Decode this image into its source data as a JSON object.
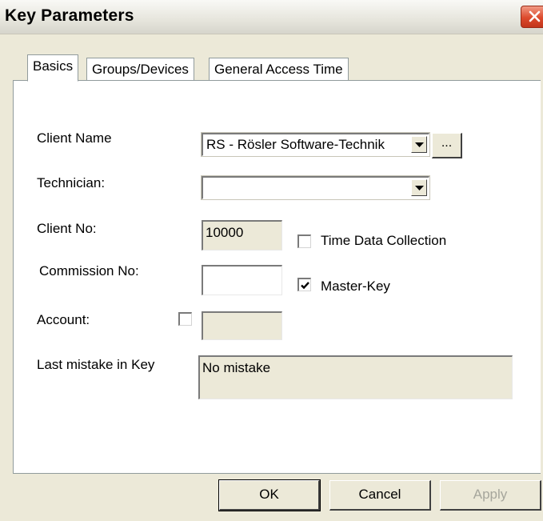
{
  "window": {
    "title": "Key Parameters"
  },
  "tabs": [
    {
      "label": "Basics",
      "active": true
    },
    {
      "label": "Groups/Devices",
      "active": false
    },
    {
      "label": "General Access Time",
      "active": false
    }
  ],
  "form": {
    "client_name": {
      "label": "Client Name",
      "value": "RS - Rösler Software-Technik",
      "browse_label": "..."
    },
    "technician": {
      "label": "Technician:",
      "value": ""
    },
    "client_no": {
      "label": "Client No:",
      "value": "10000"
    },
    "commission_no": {
      "label": "Commission No:",
      "value": ""
    },
    "account": {
      "label": "Account:",
      "checked": false,
      "value": ""
    },
    "last_mistake": {
      "label": "Last mistake in Key",
      "value": "No mistake"
    },
    "time_data_collection": {
      "label": "Time Data Collection",
      "checked": false
    },
    "master_key": {
      "label": "Master-Key",
      "checked": true
    }
  },
  "buttons": {
    "ok": "OK",
    "cancel": "Cancel",
    "apply": "Apply"
  },
  "icons": {
    "close": "close-icon",
    "dropdown": "chevron-down-icon",
    "check": "checkmark-icon"
  },
  "colors": {
    "dialog_bg": "#ece9d8",
    "close_button": "#dc4a2c",
    "panel_bg": "#ffffff"
  }
}
